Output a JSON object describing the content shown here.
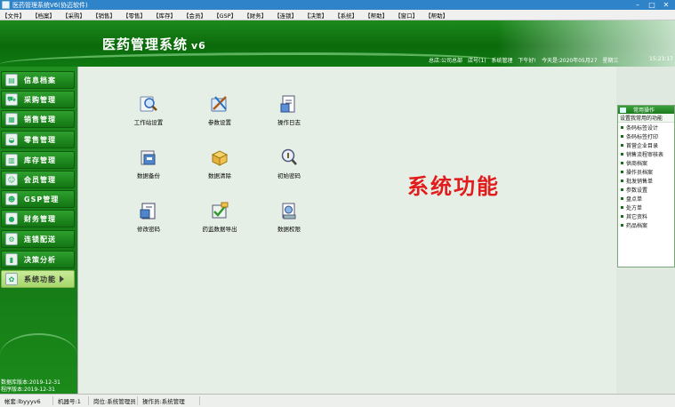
{
  "window": {
    "title": "医药管理系统V6(协迈软件)",
    "buttons": [
      "–",
      "□",
      "✕"
    ]
  },
  "menu": [
    "【文件】",
    "【档案】",
    "【采购】",
    "【销售】",
    "【零售】",
    "【库存】",
    "【会员】",
    "【GSP】",
    "【财务】",
    "【连锁】",
    "【决策】",
    "【系统】",
    "【帮助】",
    "【窗口】",
    "【帮助】"
  ],
  "header": {
    "app_name": "医药管理系统",
    "version": "v6",
    "status": {
      "company": "总店:公司总部",
      "store": "店号(1)",
      "operator": "系统管理",
      "greeting": "下午好!",
      "date": "今天是:2020年05月27",
      "weekday": "星期三",
      "clock": "15:23:17"
    }
  },
  "sidebar": {
    "items": [
      {
        "label": "信息档案",
        "icon": "folder-icon"
      },
      {
        "label": "采购管理",
        "icon": "cart-icon"
      },
      {
        "label": "销售管理",
        "icon": "document-icon"
      },
      {
        "label": "零售管理",
        "icon": "basket-icon"
      },
      {
        "label": "库存管理",
        "icon": "warehouse-icon"
      },
      {
        "label": "会员管理",
        "icon": "members-icon"
      },
      {
        "label": "GSP管理",
        "icon": "people-icon"
      },
      {
        "label": "财务管理",
        "icon": "coins-icon"
      },
      {
        "label": "连锁配送",
        "icon": "chain-icon"
      },
      {
        "label": "决策分析",
        "icon": "chart-icon"
      },
      {
        "label": "系统功能",
        "icon": "gear-icon",
        "active": true
      }
    ],
    "footer": [
      "数据库版本:2019-12-31",
      "程序版本:2019-12-31"
    ]
  },
  "main": {
    "section_title": "系统功能",
    "tiles": [
      {
        "label": "工作站设置",
        "icon": "workstation-search-icon"
      },
      {
        "label": "参数设置",
        "icon": "tools-icon"
      },
      {
        "label": "操作日志",
        "icon": "log-icon"
      },
      {
        "label": "数据备份",
        "icon": "backup-icon"
      },
      {
        "label": "数据清除",
        "icon": "clear-box-icon"
      },
      {
        "label": "初始密码",
        "icon": "key-magnifier-icon"
      },
      {
        "label": "修改密码",
        "icon": "edit-password-icon"
      },
      {
        "label": "药监数据导出",
        "icon": "export-check-icon"
      },
      {
        "label": "数据权限",
        "icon": "permission-icon"
      }
    ]
  },
  "right_panel": {
    "title": "常用操作",
    "subtitle": "设置我常用的功能",
    "items": [
      "条码标签设计",
      "条码标签打印",
      "首营企业目录",
      "销售流程审核表",
      "供商档案",
      "操作员档案",
      "批发销售单",
      "参数设置",
      "盘点单",
      "处方单",
      "其它资料",
      "药品档案"
    ]
  },
  "statusbar": {
    "cells": [
      "帐套:lbyyyv6",
      "机器号:1",
      "岗位:系统管理员",
      "操作员:系统管理"
    ]
  }
}
